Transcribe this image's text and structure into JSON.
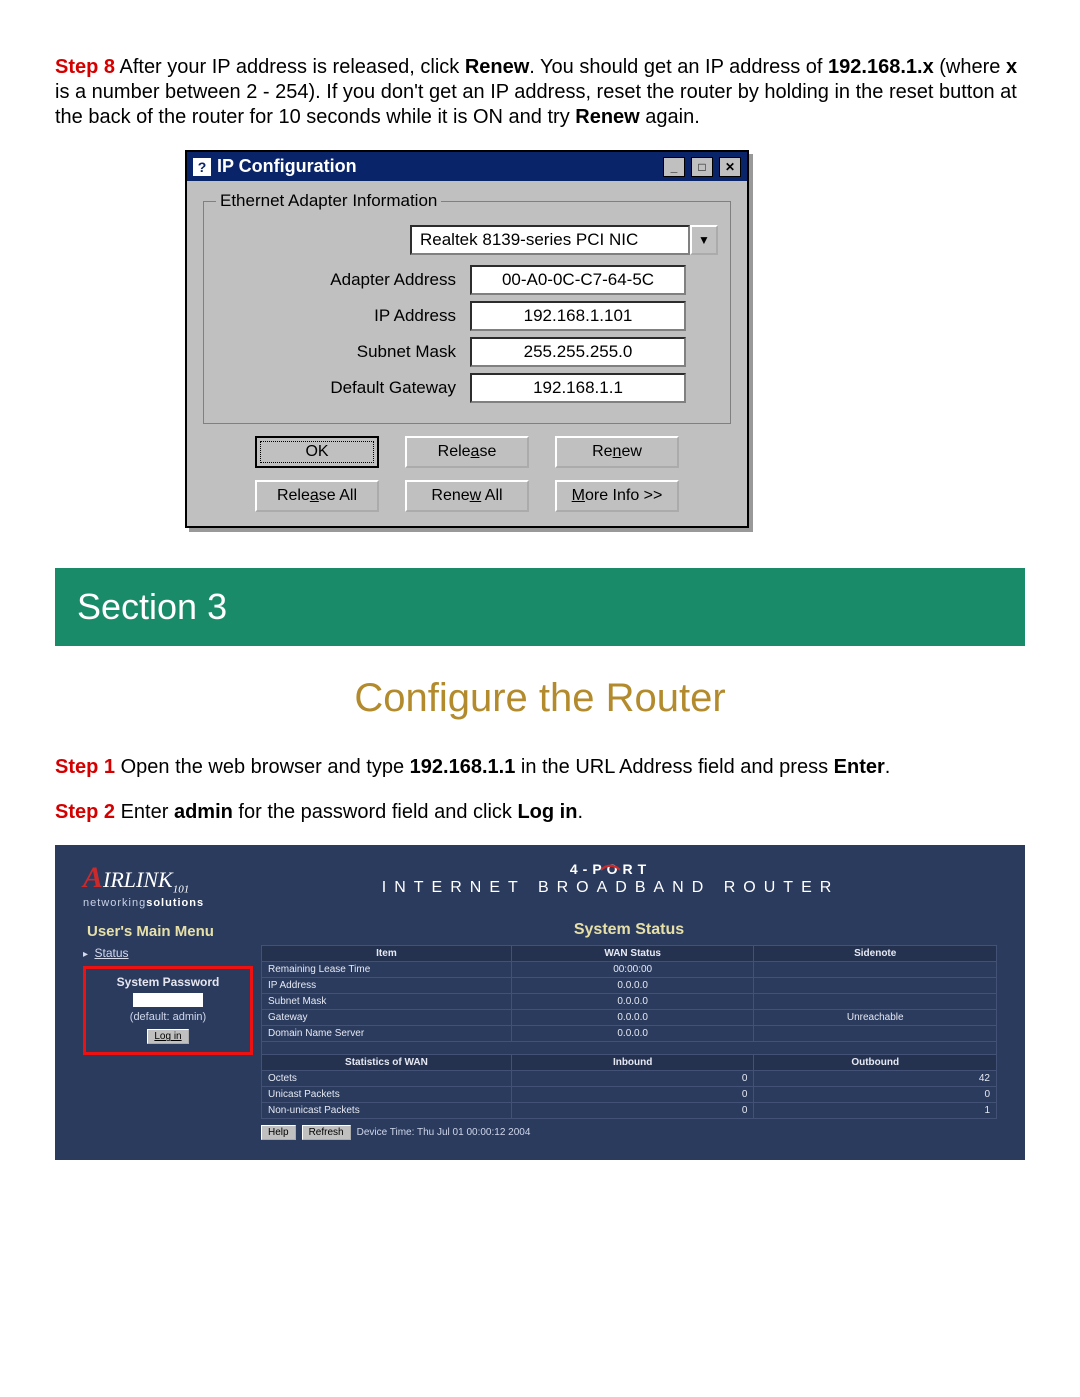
{
  "step8": {
    "label": "Step 8",
    "text_before_renew": " After your IP address is released, click ",
    "renew": "Renew",
    "text_mid": ". You should get an IP address of ",
    "ip_example": "192.168.1.x",
    "text_where": " (where ",
    "x": "x",
    "text_range": " is a number between 2 - 254). If you don't get an IP address, reset the router by holding in the reset button at the back of the router for 10 seconds while it is ON and try ",
    "renew2": "Renew",
    "text_end": " again."
  },
  "ipcfg": {
    "title": "IP Configuration",
    "group": "Ethernet  Adapter Information",
    "adapter": "Realtek 8139-series PCI NIC",
    "rows": {
      "adapter_address": {
        "k": "Adapter Address",
        "v": "00-A0-0C-C7-64-5C"
      },
      "ip_address": {
        "k": "IP Address",
        "v": "192.168.1.101"
      },
      "subnet_mask": {
        "k": "Subnet Mask",
        "v": "255.255.255.0"
      },
      "default_gateway": {
        "k": "Default Gateway",
        "v": "192.168.1.1"
      }
    },
    "buttons": {
      "ok": "OK",
      "release_pre": "Rele",
      "release_u": "a",
      "release_post": "se",
      "renew_pre": "Re",
      "renew_u": "n",
      "renew_post": "ew",
      "release_all_pre": "Rele",
      "release_all_u": "a",
      "release_all_post": "se All",
      "renew_all_pre": "Rene",
      "renew_all_u": "w",
      "renew_all_post": " All",
      "more_pre": "",
      "more_u": "M",
      "more_post": "ore Info >>"
    }
  },
  "section_banner": "Section 3",
  "section_title": "Configure the Router",
  "step1": {
    "label": "Step 1",
    "t1": " Open the web browser and type ",
    "ip": "192.168.1.1",
    "t2": " in the URL Address field and press ",
    "enter": "Enter",
    "t3": "."
  },
  "step2": {
    "label": "Step 2",
    "t1": " Enter ",
    "admin": "admin",
    "t2": " for the password field and click ",
    "login": "Log in",
    "t3": "."
  },
  "router": {
    "brand_main": "IRLINK",
    "brand_sub": "101",
    "brand_tag_a": "networking",
    "brand_tag_b": "solutions",
    "line1": "4-PORT",
    "line2": "INTERNET  BROADBAND  ROUTER",
    "users_main_menu": "User's Main Menu",
    "status": "Status",
    "sp_title": "System Password",
    "default": "(default: admin)",
    "login_btn": "Log in",
    "system_status": "System Status",
    "tbl1_headers": {
      "c1": "Item",
      "c2": "WAN Status",
      "c3": "Sidenote"
    },
    "tbl1_rows": [
      {
        "c1": "Remaining Lease Time",
        "c2": "00:00:00",
        "c3": ""
      },
      {
        "c1": "IP Address",
        "c2": "0.0.0.0",
        "c3": ""
      },
      {
        "c1": "Subnet Mask",
        "c2": "0.0.0.0",
        "c3": ""
      },
      {
        "c1": "Gateway",
        "c2": "0.0.0.0",
        "c3": "Unreachable"
      },
      {
        "c1": "Domain Name Server",
        "c2": "0.0.0.0",
        "c3": ""
      }
    ],
    "tbl2_headers": {
      "c1": "Statistics of WAN",
      "c2": "Inbound",
      "c3": "Outbound"
    },
    "tbl2_rows": [
      {
        "c1": "Octets",
        "c2": "0",
        "c3": "42"
      },
      {
        "c1": "Unicast Packets",
        "c2": "0",
        "c3": "0"
      },
      {
        "c1": "Non-unicast Packets",
        "c2": "0",
        "c3": "1"
      }
    ],
    "help": "Help",
    "refresh": "Refresh",
    "device_time": "Device Time: Thu Jul 01 00:00:12 2004"
  }
}
